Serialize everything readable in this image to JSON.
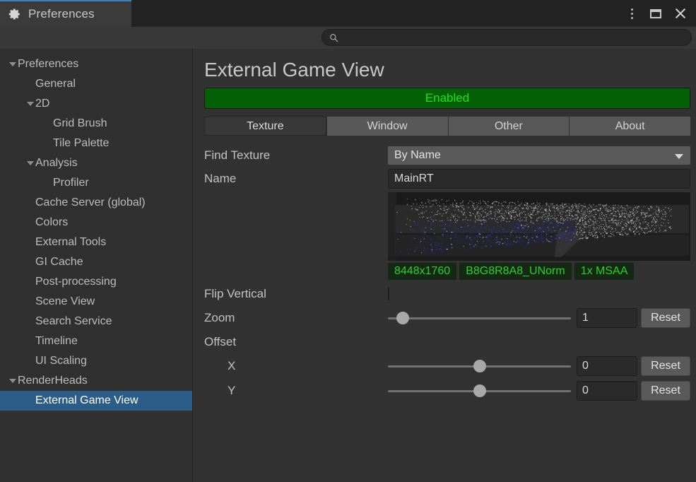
{
  "window": {
    "tab_title": "Preferences",
    "gear_icon": "gear-icon",
    "controls": {
      "menu": "kebab-menu-icon",
      "maximize": "maximize-icon",
      "close": "close-icon"
    },
    "accent_color": "#3d7fb8"
  },
  "search": {
    "value": "",
    "placeholder": "",
    "icon": "search-icon"
  },
  "sidebar": {
    "items": [
      {
        "label": "Preferences",
        "depth": 0,
        "twisty": "open",
        "selected": false
      },
      {
        "label": "General",
        "depth": 1,
        "twisty": "none",
        "selected": false
      },
      {
        "label": "2D",
        "depth": 1,
        "twisty": "open",
        "selected": false
      },
      {
        "label": "Grid Brush",
        "depth": 2,
        "twisty": "none",
        "selected": false
      },
      {
        "label": "Tile Palette",
        "depth": 2,
        "twisty": "none",
        "selected": false
      },
      {
        "label": "Analysis",
        "depth": 1,
        "twisty": "open",
        "selected": false
      },
      {
        "label": "Profiler",
        "depth": 2,
        "twisty": "none",
        "selected": false
      },
      {
        "label": "Cache Server (global)",
        "depth": 1,
        "twisty": "none",
        "selected": false
      },
      {
        "label": "Colors",
        "depth": 1,
        "twisty": "none",
        "selected": false
      },
      {
        "label": "External Tools",
        "depth": 1,
        "twisty": "none",
        "selected": false
      },
      {
        "label": "GI Cache",
        "depth": 1,
        "twisty": "none",
        "selected": false
      },
      {
        "label": "Post-processing",
        "depth": 1,
        "twisty": "none",
        "selected": false
      },
      {
        "label": "Scene View",
        "depth": 1,
        "twisty": "none",
        "selected": false
      },
      {
        "label": "Search Service",
        "depth": 1,
        "twisty": "none",
        "selected": false
      },
      {
        "label": "Timeline",
        "depth": 1,
        "twisty": "none",
        "selected": false
      },
      {
        "label": "UI Scaling",
        "depth": 1,
        "twisty": "none",
        "selected": false
      },
      {
        "label": "RenderHeads",
        "depth": 0,
        "twisty": "open",
        "selected": false
      },
      {
        "label": "External Game View",
        "depth": 1,
        "twisty": "none",
        "selected": true
      }
    ],
    "selection_color": "#2c5d87"
  },
  "panel": {
    "title": "External Game View",
    "status": {
      "label": "Enabled",
      "bg_color": "#046004",
      "text_color": "#19e219"
    },
    "tabs": [
      {
        "label": "Texture",
        "active": true
      },
      {
        "label": "Window",
        "active": false
      },
      {
        "label": "Other",
        "active": false
      },
      {
        "label": "About",
        "active": false
      }
    ],
    "fields": {
      "find_texture": {
        "label": "Find Texture",
        "value": "By Name",
        "chevron": "chevron-down-icon"
      },
      "name": {
        "label": "Name",
        "value": "MainRT",
        "placeholder": ""
      }
    },
    "texture_info": [
      "8448x1760",
      "B8G8R8A8_UNorm",
      "1x MSAA"
    ],
    "flip_vertical": {
      "label": "Flip Vertical",
      "checked": false
    },
    "zoom": {
      "label": "Zoom",
      "value": "1",
      "percent": 8,
      "reset_label": "Reset"
    },
    "offset": {
      "label": "Offset",
      "x": {
        "label": "X",
        "value": "0",
        "percent": 50,
        "reset_label": "Reset"
      },
      "y": {
        "label": "Y",
        "value": "0",
        "percent": 50,
        "reset_label": "Reset"
      }
    }
  }
}
